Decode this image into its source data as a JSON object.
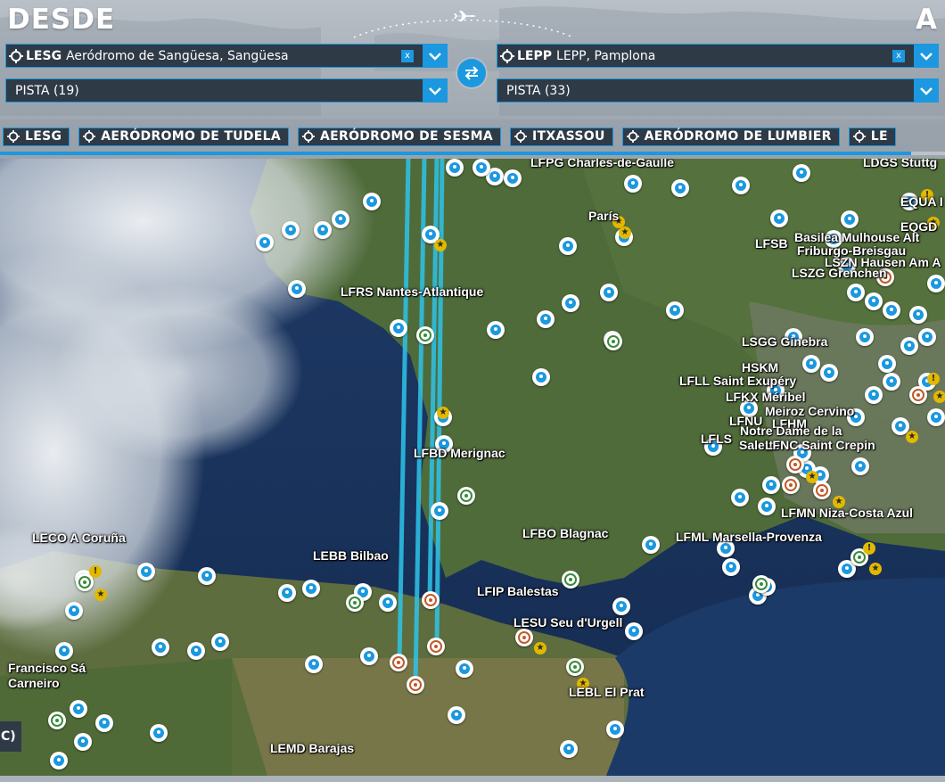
{
  "header": {
    "from_title": "DESDE",
    "to_title": "A"
  },
  "departure": {
    "code": "LESG",
    "name": "Aeródromo de Sangüesa, Sangüesa",
    "clear_label": "x",
    "runway": "PISTA (19)"
  },
  "arrival": {
    "code": "LEPP",
    "name": "LEPP, Pamplona",
    "clear_label": "x",
    "runway": "PISTA (33)"
  },
  "shortcuts": [
    "LESG",
    "AERÓDROMO DE TUDELA",
    "AERÓDROMO DE SESMA",
    "ITXASSOU",
    "AERÓDROMO DE LUMBIER",
    "LE"
  ],
  "map_labels": {
    "lfpg": "LFPG Charles-de-Gaulle",
    "ldgs": "LDGS Stuttg",
    "paris": "París",
    "eqa": "EQUA I",
    "eqd": "EQGD",
    "lfsb": "LFSB",
    "basilea": "Basilea Mulhouse Alt",
    "friburgo": "Friburgo-Breisgau",
    "hausen": "LSZN Hausen Am A",
    "lszg": "LSZG Grenchen",
    "lfrs": "LFRS Nantes-Atlantique",
    "lsgg": "LSGG Ginebra",
    "hskm": "HSKM",
    "lfll": "LFLL Saint Exupéry",
    "lfkx": "LFKX Méribel",
    "meiroz": "Meiroz Cervino",
    "lfnu": "LFNU",
    "lfhm": "LFHM",
    "notre_dame": "Notre Dame de la",
    "lfls": "LFLS",
    "salette": "Salette",
    "lfnc": "LFNC Saint Crepin",
    "lfbd": "LFBD Merignac",
    "lfmn": "LFMN Niza-Costa Azul",
    "leco": "LECO A Coruña",
    "lfbo": "LFBO Blagnac",
    "lfml": "LFML Marsella-Provenza",
    "lebb": "LEBB Bilbao",
    "lfip": "LFIP Balestas",
    "lesu": "LESU Seu d'Urgell",
    "francisco": "Francisco Sá",
    "carneiro": "Carneiro",
    "lebl": "LEBL El Prat",
    "lemd": "LEMD Barajas",
    "corner": "C)"
  },
  "colors": {
    "accent": "#1b98e0",
    "panel": "#2f3a47",
    "route_line": "#2ec4ea",
    "star": "#e2b800"
  },
  "icons": {
    "field_pin": "crosshair-pin-icon",
    "dropdown": "chevron-down-icon",
    "swap": "swap-arrows-icon",
    "plane": "airplane-icon"
  }
}
